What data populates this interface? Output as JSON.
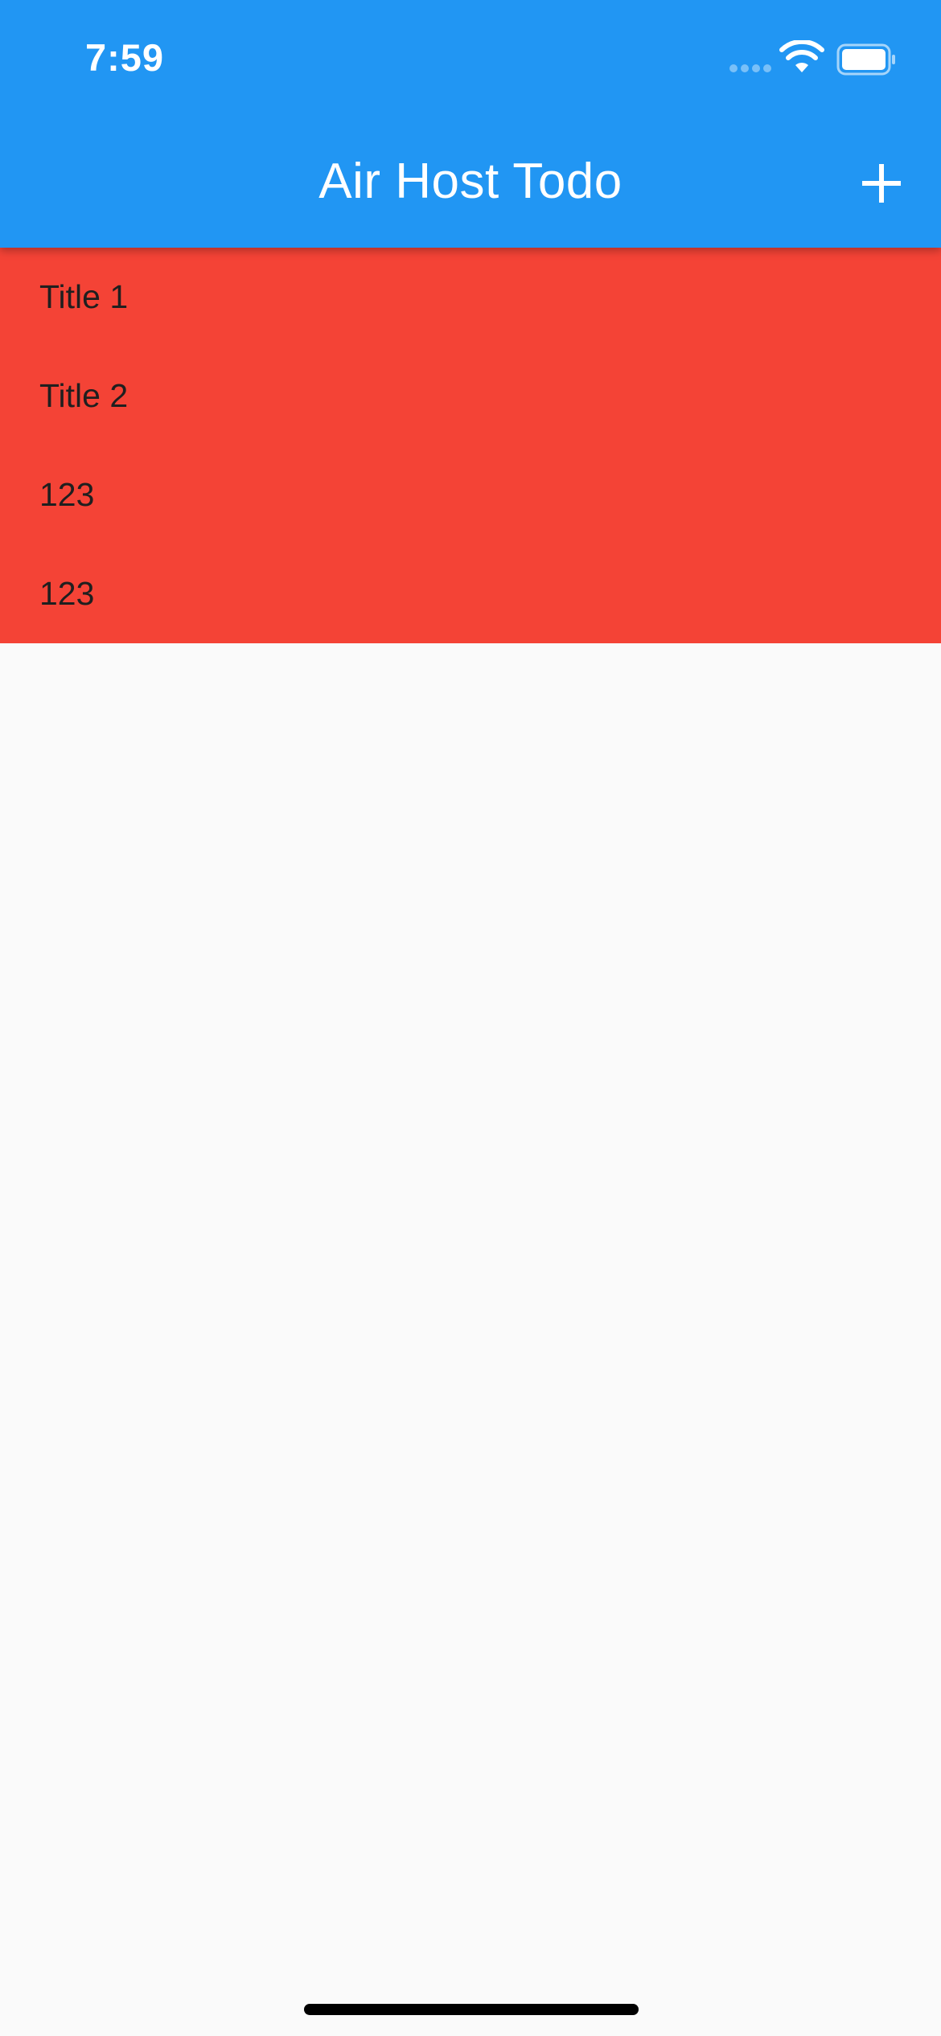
{
  "status_bar": {
    "time": "7:59",
    "icons": [
      "cellular-signal-icon",
      "wifi-icon",
      "battery-icon"
    ]
  },
  "app_bar": {
    "title": "Air Host Todo",
    "action_icon": "plus-icon"
  },
  "todos": [
    {
      "title": "Title 1"
    },
    {
      "title": "Title 2"
    },
    {
      "title": "123"
    },
    {
      "title": "123"
    }
  ],
  "colors": {
    "app_bar": "#2196f3",
    "list_background": "#f44336",
    "page_background": "#fafafa"
  }
}
